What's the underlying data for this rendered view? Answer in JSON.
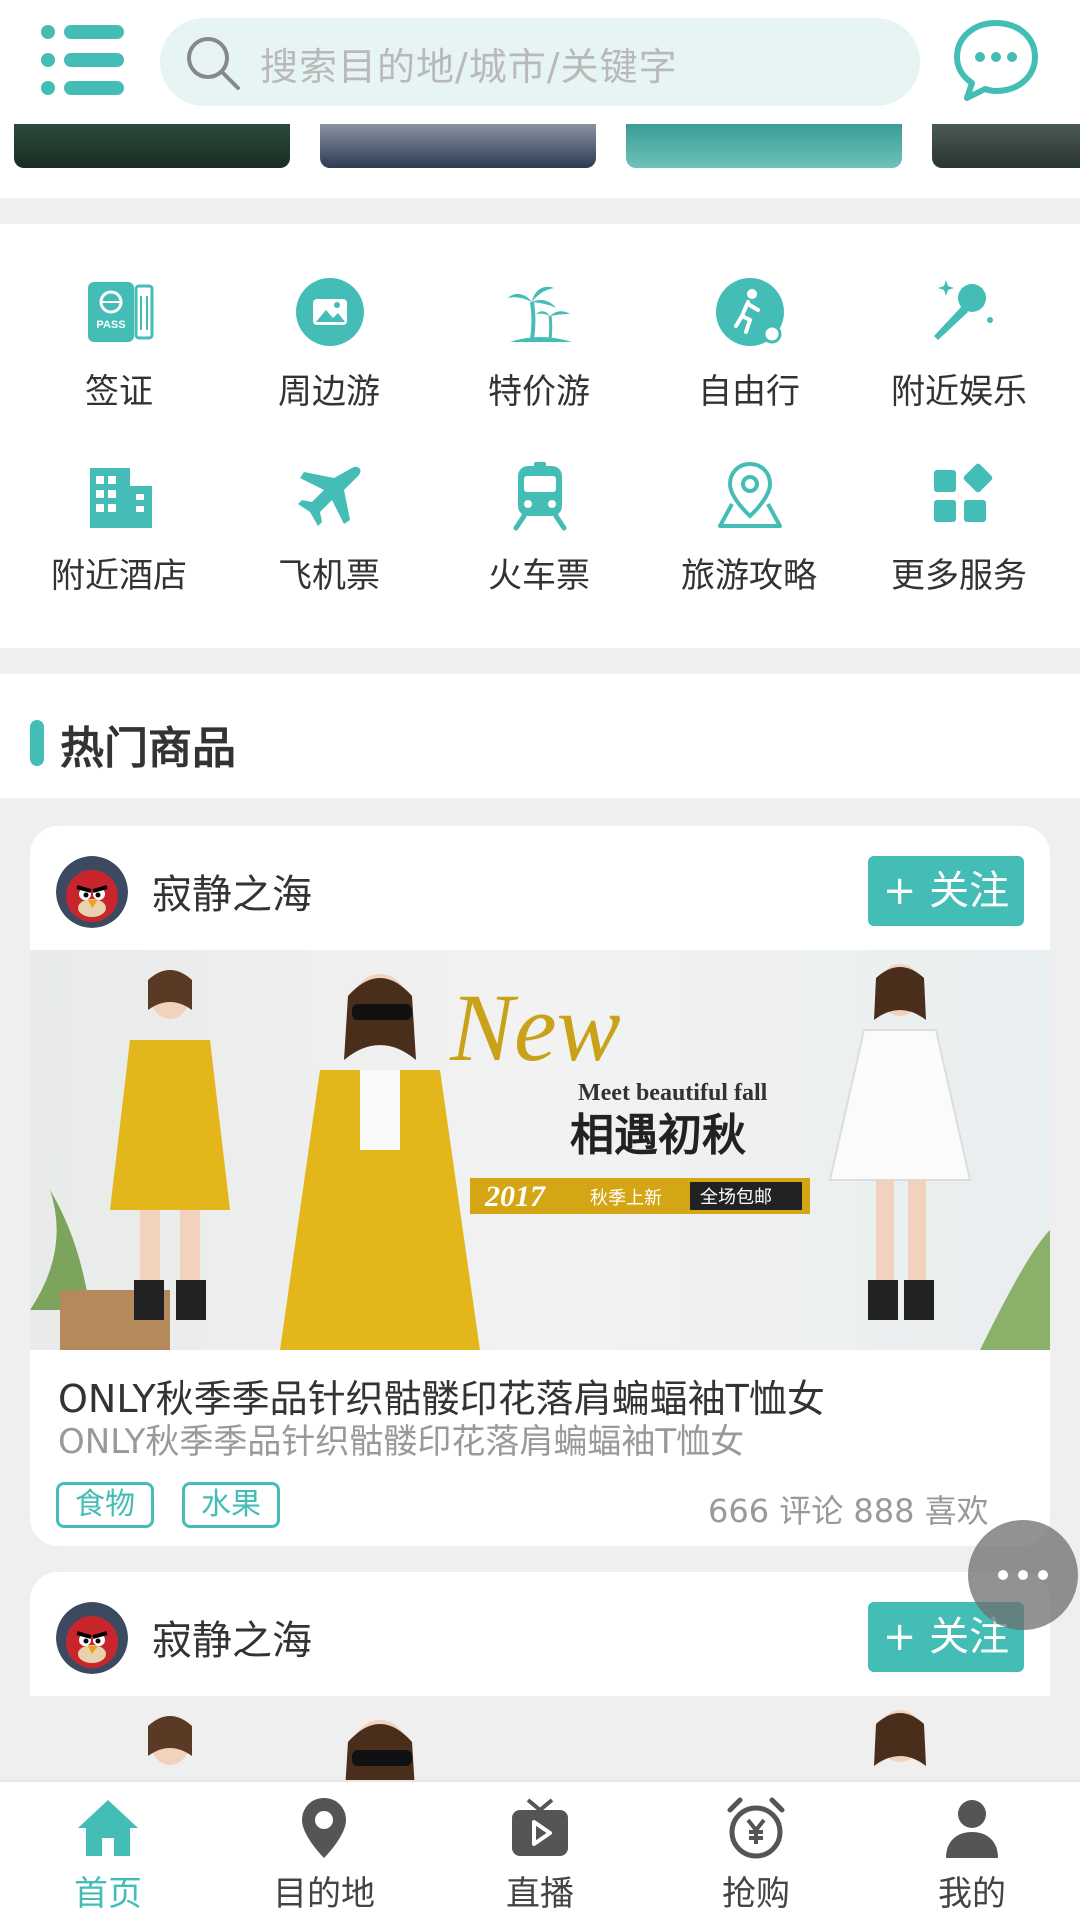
{
  "header": {
    "search_placeholder": "搜索目的地/城市/关键字"
  },
  "services": [
    {
      "label": "签证",
      "icon": "passport-icon"
    },
    {
      "label": "周边游",
      "icon": "photo-icon"
    },
    {
      "label": "特价游",
      "icon": "palm-tree-icon"
    },
    {
      "label": "自由行",
      "icon": "walking-person-icon"
    },
    {
      "label": "附近娱乐",
      "icon": "microphone-icon"
    },
    {
      "label": "附近酒店",
      "icon": "hotel-icon"
    },
    {
      "label": "飞机票",
      "icon": "airplane-icon"
    },
    {
      "label": "火车票",
      "icon": "train-icon"
    },
    {
      "label": "旅游攻略",
      "icon": "map-pin-icon"
    },
    {
      "label": "更多服务",
      "icon": "grid-icon"
    }
  ],
  "hot": {
    "title": "热门商品"
  },
  "cards": [
    {
      "shop": "寂静之海",
      "follow": "+ 关注",
      "title": "ONLY秋季季品针织骷髅印花落肩蝙蝠袖T恤女",
      "subtitle": "ONLY秋季季品针织骷髅印花落肩蝙蝠袖T恤女",
      "tags": [
        "食物",
        "水果"
      ],
      "stats": "666 评论   888 喜欢",
      "banner": {
        "new": "New",
        "tagline": "Meet beautiful fall",
        "headline": "相遇初秋",
        "year": "2017",
        "ribbon": "秋季上新",
        "shipping": "全场包邮"
      }
    },
    {
      "shop": "寂静之海",
      "follow": "+ 关注"
    }
  ],
  "tabbar": [
    {
      "label": "首页",
      "icon": "home-icon",
      "active": true
    },
    {
      "label": "目的地",
      "icon": "location-icon",
      "active": false
    },
    {
      "label": "直播",
      "icon": "tv-play-icon",
      "active": false
    },
    {
      "label": "抢购",
      "icon": "alarm-yen-icon",
      "active": false
    },
    {
      "label": "我的",
      "icon": "user-icon",
      "active": false
    }
  ],
  "colors": {
    "accent": "#43bdb5",
    "search_bg": "#e6f5f4",
    "text": "#333333",
    "muted": "#999999"
  }
}
